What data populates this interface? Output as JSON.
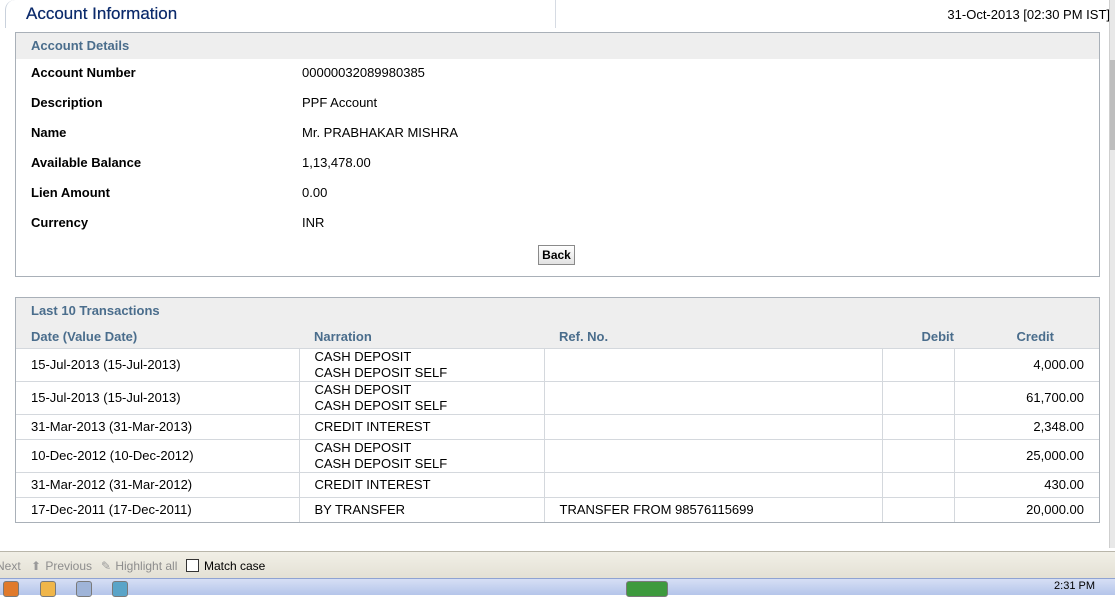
{
  "header": {
    "title": "Account Information",
    "datetime": "31-Oct-2013 [02:30 PM IST]"
  },
  "account_details": {
    "heading": "Account Details",
    "rows": [
      {
        "label": "Account Number",
        "value": "00000032089980385"
      },
      {
        "label": "Description",
        "value": "PPF Account"
      },
      {
        "label": "Name",
        "value": "Mr. PRABHAKAR MISHRA"
      },
      {
        "label": "Available Balance",
        "value": "1,13,478.00"
      },
      {
        "label": "Lien Amount",
        "value": "0.00"
      },
      {
        "label": "Currency",
        "value": "INR"
      }
    ],
    "back_label": "Back"
  },
  "transactions": {
    "heading": "Last 10 Transactions",
    "columns": [
      "Date (Value Date)",
      "Narration",
      "Ref. No.",
      "Debit",
      "Credit"
    ],
    "rows": [
      {
        "date": "15-Jul-2013 (15-Jul-2013)",
        "narration1": "CASH DEPOSIT",
        "narration2": "CASH DEPOSIT SELF",
        "ref": "",
        "debit": "",
        "credit": "4,000.00"
      },
      {
        "date": "15-Jul-2013 (15-Jul-2013)",
        "narration1": "CASH DEPOSIT",
        "narration2": "CASH DEPOSIT SELF",
        "ref": "",
        "debit": "",
        "credit": "61,700.00"
      },
      {
        "date": "31-Mar-2013 (31-Mar-2013)",
        "narration1": "CREDIT INTEREST",
        "narration2": "",
        "ref": "",
        "debit": "",
        "credit": "2,348.00"
      },
      {
        "date": "10-Dec-2012 (10-Dec-2012)",
        "narration1": "CASH DEPOSIT",
        "narration2": "CASH DEPOSIT SELF",
        "ref": "",
        "debit": "",
        "credit": "25,000.00"
      },
      {
        "date": "31-Mar-2012 (31-Mar-2012)",
        "narration1": "CREDIT INTEREST",
        "narration2": "",
        "ref": "",
        "debit": "",
        "credit": "430.00"
      },
      {
        "date": "17-Dec-2011 (17-Dec-2011)",
        "narration1": "BY TRANSFER",
        "narration2": "",
        "ref": "TRANSFER FROM 98576115699",
        "debit": "",
        "credit": "20,000.00"
      }
    ]
  },
  "find_bar": {
    "next": "Next",
    "previous": "Previous",
    "highlight_all": "Highlight all",
    "match_case": "Match case"
  },
  "taskbar": {
    "clock": "2:31 PM"
  }
}
